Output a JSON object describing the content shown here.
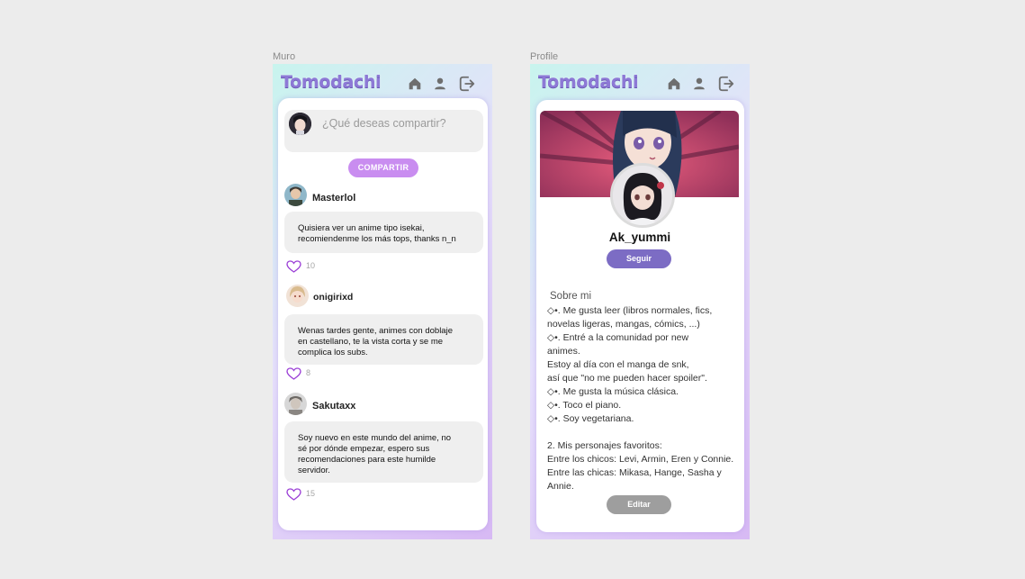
{
  "frames": {
    "muro_label": "Muro",
    "profile_label": "Profile"
  },
  "app": {
    "logo": "Tomodachi",
    "nav_icons": [
      "home-icon",
      "user-icon",
      "logout-icon"
    ]
  },
  "muro": {
    "compose_placeholder": "¿Qué deseas compartir?",
    "share_button": "COMPARTIR",
    "posts": [
      {
        "user": "Masterlol",
        "text_lines": [
          "Quisiera ver un anime tipo isekai,",
          "recomiendenme los más tops, thanks n_n"
        ],
        "likes": "10"
      },
      {
        "user": "onigirixd",
        "text_lines": [
          "Wenas tardes gente, animes con doblaje",
          "en castellano, te la vista corta y se me",
          "complica los subs."
        ],
        "likes": "8"
      },
      {
        "user": "Sakutaxx",
        "text_lines": [
          "Soy nuevo en este mundo del anime, no",
          "sé por dónde empezar, espero sus",
          "recomendaciones para este humilde",
          "servidor."
        ],
        "likes": "15"
      }
    ]
  },
  "profile": {
    "username": "Ak_yummi",
    "follow_button": "Seguir",
    "about_title": "Sobre mi",
    "about_lines": [
      "◇•. Me gusta leer (libros normales, fics,",
      "novelas ligeras, mangas, cómics, ...)",
      "◇•. Entré a la comunidad por new",
      "animes.",
      "Estoy al día con el manga de snk,",
      "así que \"no me pueden hacer spoiler\".",
      "◇•. Me gusta la música clásica.",
      "◇•. Toco el piano.",
      "◇•. Soy vegetariana.",
      "",
      "2. Mis personajes favoritos:",
      "Entre los chicos: Levi, Armin, Eren y Connie.",
      "Entre las chicas: Mikasa, Hange, Sasha y",
      "Annie."
    ],
    "edit_button": "Editar"
  },
  "colors": {
    "accent_purple": "#7c6cc4",
    "share_pink": "#c98df0",
    "logo": "#8d79d6",
    "edit_gray": "#9e9e9e",
    "like_outline": "#9b3fd6"
  }
}
